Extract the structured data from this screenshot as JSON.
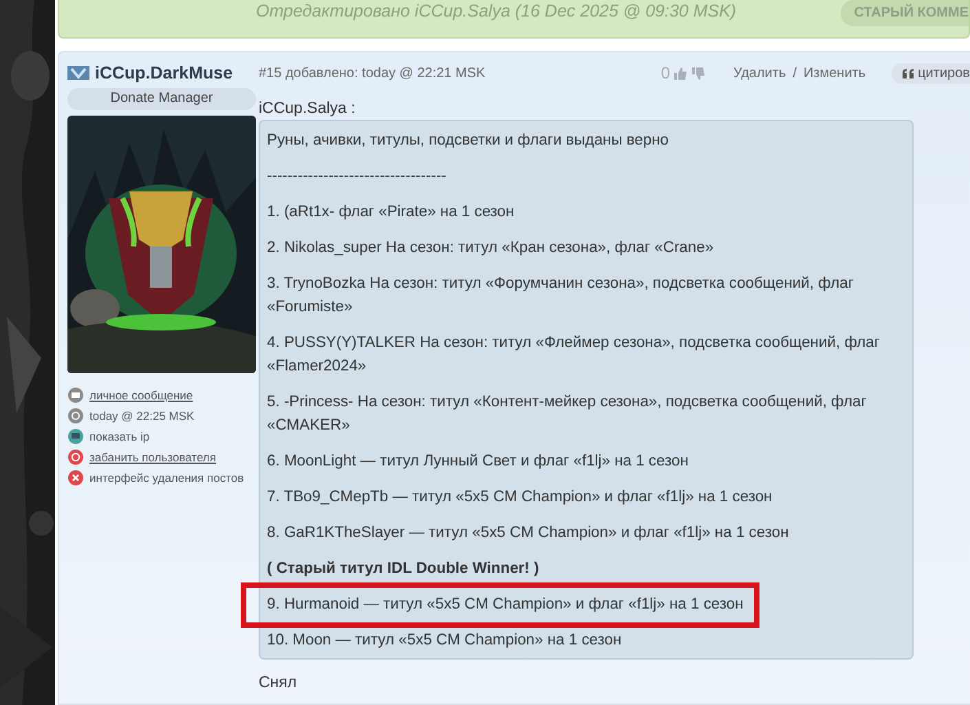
{
  "edit_note": {
    "text": "Отредактировано iCCup.Salya (16 Dec 2025 @ 09:30 MSK)",
    "button": "СТАРЫЙ КОММЕ"
  },
  "post": {
    "author": "iCCup.DarkMuse",
    "role": "Donate Manager",
    "author_links": [
      {
        "kind": "message",
        "label": "личное сообщение",
        "link": true
      },
      {
        "kind": "clock",
        "label": "today @ 22:25 MSK",
        "link": false
      },
      {
        "kind": "ip",
        "label": "показать ip",
        "link": false
      },
      {
        "kind": "ban",
        "label": "забанить пользователя",
        "link": true
      },
      {
        "kind": "delete",
        "label": "интерфейс удаления постов",
        "link": false
      }
    ],
    "meta": "#15 добавлено: today @ 22:21 MSK",
    "votes": "0",
    "actions": [
      "Удалить",
      "Изменить"
    ],
    "separator": "/",
    "quote_button": "цитиров",
    "quote": {
      "author": "iCCup.Salya :",
      "lines": [
        {
          "text": "Руны, ачивки, титулы, подсветки и флаги выданы верно",
          "bold": false,
          "highlighted": false
        },
        {
          "text": "-----------------------------------",
          "bold": false,
          "highlighted": false
        },
        {
          "text": "1. (aRt1x- флаг «Pirate» на 1 сезон",
          "bold": false,
          "highlighted": false
        },
        {
          "text": "2. Nikolas_super На сезон: титул «Кран сезона», флаг «Crane»",
          "bold": false,
          "highlighted": false
        },
        {
          "text": "3. TrynoBozka На сезон: титул «Форумчанин сезона», подсветка сообщений, флаг «Forumiste»",
          "bold": false,
          "highlighted": false
        },
        {
          "text": "4. PUSSY(Y)TALKER На сезон: титул «Флеймер сезона», подсветка сообщений, флаг «Flamer2024»",
          "bold": false,
          "highlighted": false
        },
        {
          "text": "5. -Princess- На сезон: титул «Контент-мейкер сезона», подсветка сообщений, флаг «CMAKER»",
          "bold": false,
          "highlighted": false
        },
        {
          "text": "6. MoonLight — титул Лунный Свет и флаг «f1lj» на 1 сезон",
          "bold": false,
          "highlighted": false
        },
        {
          "text": "7. TBo9_CMepTb — титул «5x5 CM Champion» и флаг «f1lj» на 1 сезон",
          "bold": false,
          "highlighted": false
        },
        {
          "text": "8. GaR1KTheSlayer — титул «5x5 CM Champion» и флаг «f1lj» на 1 сезон",
          "bold": false,
          "highlighted": false
        },
        {
          "text": "( Старый титул IDL Double Winner! )",
          "bold": true,
          "highlighted": false
        },
        {
          "text": "9. Hurmanoid — титул «5x5 CM Champion» и флаг «f1lj» на 1 сезон",
          "bold": false,
          "highlighted": true
        },
        {
          "text": "10. Moon — титул «5x5 CM Champion» на 1 сезон",
          "bold": false,
          "highlighted": false
        }
      ]
    },
    "reply": "Снял"
  }
}
